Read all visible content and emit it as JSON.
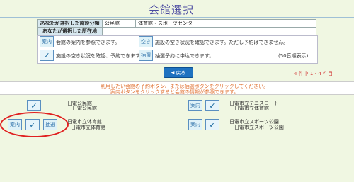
{
  "page": {
    "title": "会館選択"
  },
  "info": {
    "category_label": "あなたが選択した施設分類",
    "category_value1": "公民館",
    "category_value2": "体育館・スポーツセンター",
    "area_label": "あなたが選択した所在地",
    "area_value": ""
  },
  "legend": {
    "info_text": "会館の案内を参照できます。",
    "vacancy_text": "施設の空き状況を確認できます。ただし予約はできません。",
    "reserve_text": "施設の空き状況を確認、予約できます。",
    "lottery_text": "抽選予約に申込できます。",
    "sort_text": "(50音順表示)"
  },
  "nav": {
    "back_label": "戻る",
    "count_text": "4 件中 1 - 4 件目"
  },
  "message": {
    "line1": "利用したい会館の予約ボタン、または抽選ボタンをクリックしてください。",
    "line2": "案内ボタンをクリックすると会館の情報が参照できます。"
  },
  "facilities": [
    {
      "name": "日電公民館",
      "sub": "日電公民館"
    },
    {
      "name": "日電市立テニスコート",
      "sub": "日電市立体育館"
    },
    {
      "name": "日電市立体育館",
      "sub": "日電市立体育館"
    },
    {
      "name": "日電市立スポーツ公園",
      "sub": "日電市立スポーツ公園"
    }
  ],
  "icons": {
    "info": "案内",
    "vacancy": "空き",
    "reserve": "予約",
    "lottery": "抽選"
  },
  "colors": {
    "background": "#f0f7e2",
    "title": "#4a4aa0",
    "button": "#1f72c0",
    "count": "#d03030",
    "message": "#e07030",
    "highlight": "#e02020"
  }
}
